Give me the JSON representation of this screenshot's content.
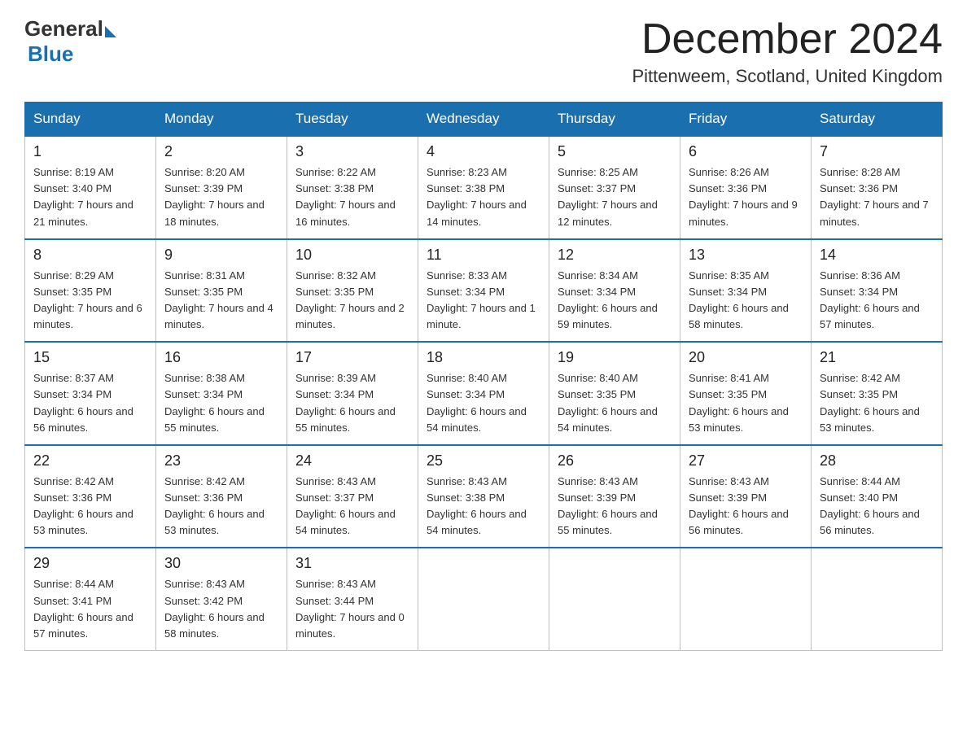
{
  "logo": {
    "general": "General",
    "blue": "Blue"
  },
  "title": "December 2024",
  "subtitle": "Pittenweem, Scotland, United Kingdom",
  "headers": [
    "Sunday",
    "Monday",
    "Tuesday",
    "Wednesday",
    "Thursday",
    "Friday",
    "Saturday"
  ],
  "weeks": [
    [
      {
        "day": "1",
        "sunrise": "8:19 AM",
        "sunset": "3:40 PM",
        "daylight": "7 hours and 21 minutes."
      },
      {
        "day": "2",
        "sunrise": "8:20 AM",
        "sunset": "3:39 PM",
        "daylight": "7 hours and 18 minutes."
      },
      {
        "day": "3",
        "sunrise": "8:22 AM",
        "sunset": "3:38 PM",
        "daylight": "7 hours and 16 minutes."
      },
      {
        "day": "4",
        "sunrise": "8:23 AM",
        "sunset": "3:38 PM",
        "daylight": "7 hours and 14 minutes."
      },
      {
        "day": "5",
        "sunrise": "8:25 AM",
        "sunset": "3:37 PM",
        "daylight": "7 hours and 12 minutes."
      },
      {
        "day": "6",
        "sunrise": "8:26 AM",
        "sunset": "3:36 PM",
        "daylight": "7 hours and 9 minutes."
      },
      {
        "day": "7",
        "sunrise": "8:28 AM",
        "sunset": "3:36 PM",
        "daylight": "7 hours and 7 minutes."
      }
    ],
    [
      {
        "day": "8",
        "sunrise": "8:29 AM",
        "sunset": "3:35 PM",
        "daylight": "7 hours and 6 minutes."
      },
      {
        "day": "9",
        "sunrise": "8:31 AM",
        "sunset": "3:35 PM",
        "daylight": "7 hours and 4 minutes."
      },
      {
        "day": "10",
        "sunrise": "8:32 AM",
        "sunset": "3:35 PM",
        "daylight": "7 hours and 2 minutes."
      },
      {
        "day": "11",
        "sunrise": "8:33 AM",
        "sunset": "3:34 PM",
        "daylight": "7 hours and 1 minute."
      },
      {
        "day": "12",
        "sunrise": "8:34 AM",
        "sunset": "3:34 PM",
        "daylight": "6 hours and 59 minutes."
      },
      {
        "day": "13",
        "sunrise": "8:35 AM",
        "sunset": "3:34 PM",
        "daylight": "6 hours and 58 minutes."
      },
      {
        "day": "14",
        "sunrise": "8:36 AM",
        "sunset": "3:34 PM",
        "daylight": "6 hours and 57 minutes."
      }
    ],
    [
      {
        "day": "15",
        "sunrise": "8:37 AM",
        "sunset": "3:34 PM",
        "daylight": "6 hours and 56 minutes."
      },
      {
        "day": "16",
        "sunrise": "8:38 AM",
        "sunset": "3:34 PM",
        "daylight": "6 hours and 55 minutes."
      },
      {
        "day": "17",
        "sunrise": "8:39 AM",
        "sunset": "3:34 PM",
        "daylight": "6 hours and 55 minutes."
      },
      {
        "day": "18",
        "sunrise": "8:40 AM",
        "sunset": "3:34 PM",
        "daylight": "6 hours and 54 minutes."
      },
      {
        "day": "19",
        "sunrise": "8:40 AM",
        "sunset": "3:35 PM",
        "daylight": "6 hours and 54 minutes."
      },
      {
        "day": "20",
        "sunrise": "8:41 AM",
        "sunset": "3:35 PM",
        "daylight": "6 hours and 53 minutes."
      },
      {
        "day": "21",
        "sunrise": "8:42 AM",
        "sunset": "3:35 PM",
        "daylight": "6 hours and 53 minutes."
      }
    ],
    [
      {
        "day": "22",
        "sunrise": "8:42 AM",
        "sunset": "3:36 PM",
        "daylight": "6 hours and 53 minutes."
      },
      {
        "day": "23",
        "sunrise": "8:42 AM",
        "sunset": "3:36 PM",
        "daylight": "6 hours and 53 minutes."
      },
      {
        "day": "24",
        "sunrise": "8:43 AM",
        "sunset": "3:37 PM",
        "daylight": "6 hours and 54 minutes."
      },
      {
        "day": "25",
        "sunrise": "8:43 AM",
        "sunset": "3:38 PM",
        "daylight": "6 hours and 54 minutes."
      },
      {
        "day": "26",
        "sunrise": "8:43 AM",
        "sunset": "3:39 PM",
        "daylight": "6 hours and 55 minutes."
      },
      {
        "day": "27",
        "sunrise": "8:43 AM",
        "sunset": "3:39 PM",
        "daylight": "6 hours and 56 minutes."
      },
      {
        "day": "28",
        "sunrise": "8:44 AM",
        "sunset": "3:40 PM",
        "daylight": "6 hours and 56 minutes."
      }
    ],
    [
      {
        "day": "29",
        "sunrise": "8:44 AM",
        "sunset": "3:41 PM",
        "daylight": "6 hours and 57 minutes."
      },
      {
        "day": "30",
        "sunrise": "8:43 AM",
        "sunset": "3:42 PM",
        "daylight": "6 hours and 58 minutes."
      },
      {
        "day": "31",
        "sunrise": "8:43 AM",
        "sunset": "3:44 PM",
        "daylight": "7 hours and 0 minutes."
      },
      null,
      null,
      null,
      null
    ]
  ],
  "labels": {
    "sunrise": "Sunrise:",
    "sunset": "Sunset:",
    "daylight": "Daylight:"
  }
}
